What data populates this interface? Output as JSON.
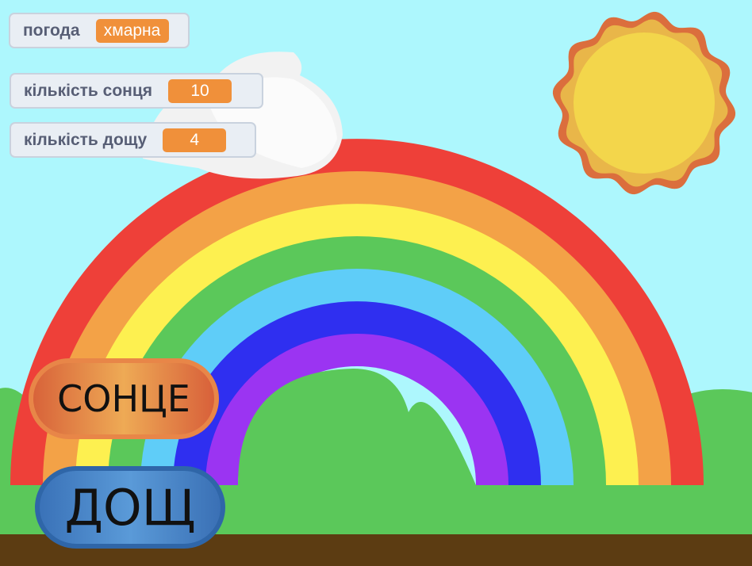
{
  "scene": {
    "colors": {
      "sky": "#adf7fd",
      "grass": "#5bc85a",
      "soil": "#5c3c12",
      "rainbow": [
        "#ee4039",
        "#f3a247",
        "#fdf050",
        "#5bc85a",
        "#5fcdf8",
        "#2f2ff0",
        "#9b34f2"
      ],
      "sun_outer": "#db6e3d",
      "sun_middle": "#e9b649",
      "sun_inner": "#f3d64b",
      "cloud": "#f2f2f2"
    }
  },
  "monitors": {
    "weather": {
      "label": "погода",
      "value": "хмарна"
    },
    "sun_count": {
      "label": "кількість сонця",
      "value": "10"
    },
    "rain_count": {
      "label": "кількість дощу",
      "value": "4"
    }
  },
  "buttons": {
    "sun": {
      "label": "СОНЦЕ"
    },
    "rain": {
      "label": "ДОЩ"
    }
  }
}
